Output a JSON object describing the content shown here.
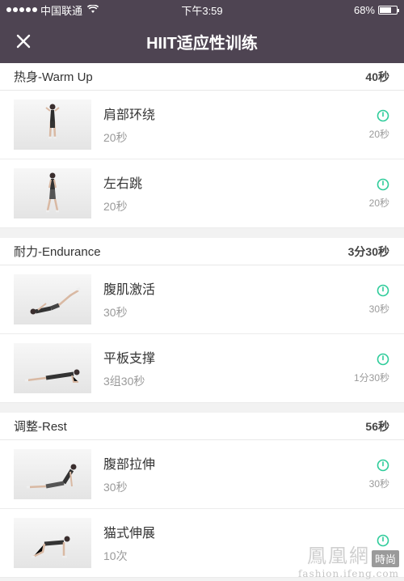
{
  "status_bar": {
    "carrier": "中国联通",
    "time": "下午3:59",
    "battery": "68%",
    "battery_level": 0.68
  },
  "nav": {
    "title": "HIIT适应性训练",
    "close_icon": "close-icon"
  },
  "accent_color": "#2ecc9a",
  "sections": [
    {
      "title": "热身-Warm Up",
      "duration": "40秒",
      "items": [
        {
          "name": "肩部环绕",
          "sub": "20秒",
          "duration": "20秒"
        },
        {
          "name": "左右跳",
          "sub": "20秒",
          "duration": "20秒"
        }
      ]
    },
    {
      "title": "耐力-Endurance",
      "duration": "3分30秒",
      "items": [
        {
          "name": "腹肌激活",
          "sub": "30秒",
          "duration": "30秒"
        },
        {
          "name": "平板支撑",
          "sub": "3组30秒",
          "duration": "1分30秒"
        }
      ]
    },
    {
      "title": "调整-Rest",
      "duration": "56秒",
      "items": [
        {
          "name": "腹部拉伸",
          "sub": "30秒",
          "duration": "30秒"
        },
        {
          "name": "猫式伸展",
          "sub": "10次",
          "duration": ""
        }
      ]
    }
  ],
  "watermark": {
    "logo": "鳳凰網",
    "badge": "時尚",
    "site": "fashion.ifeng.com"
  }
}
